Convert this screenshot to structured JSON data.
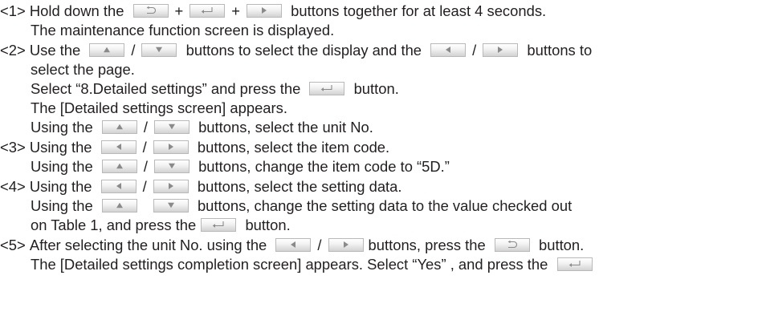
{
  "steps": [
    {
      "num": "<1>",
      "lines": [
        {
          "parts": [
            "Hold down the",
            "+",
            "+",
            "buttons together for at least 4 seconds."
          ]
        },
        {
          "parts": [
            "The maintenance function screen is displayed."
          ]
        }
      ]
    },
    {
      "num": "<2>",
      "lines": [
        {
          "parts": [
            "Use the",
            "/",
            "buttons to select the display and the",
            "/",
            "buttons to"
          ]
        },
        {
          "parts": [
            "select the page."
          ]
        },
        {
          "parts": [
            "Select “8.Detailed settings” and press the",
            "button."
          ]
        },
        {
          "parts": [
            "The [Detailed settings screen] appears."
          ]
        },
        {
          "parts": [
            "Using the",
            "/",
            "buttons, select the unit No."
          ]
        }
      ]
    },
    {
      "num": "<3>",
      "lines": [
        {
          "parts": [
            "Using the",
            "/",
            "buttons, select the item code."
          ]
        },
        {
          "parts": [
            "Using the",
            "/",
            "buttons, change the item code to “5D.”"
          ]
        }
      ]
    },
    {
      "num": "<4>",
      "lines": [
        {
          "parts": [
            "Using the",
            "/",
            "buttons, select the setting data."
          ]
        },
        {
          "parts": [
            "Using the",
            "buttons, change the setting data to the value checked out"
          ]
        },
        {
          "parts": [
            "on Table 1, and press the",
            "button."
          ]
        }
      ]
    },
    {
      "num": "<5>",
      "lines": [
        {
          "parts": [
            "After selecting the unit No. using the",
            "/",
            "buttons, press the",
            "button."
          ]
        },
        {
          "parts": [
            "The [Detailed settings completion screen] appears. Select “Yes” , and press the"
          ]
        }
      ]
    }
  ],
  "icons": {
    "return": "return-icon",
    "enter": "enter-icon",
    "up": "up-arrow-icon",
    "down": "down-arrow-icon",
    "left": "left-arrow-icon",
    "right": "right-arrow-icon"
  }
}
